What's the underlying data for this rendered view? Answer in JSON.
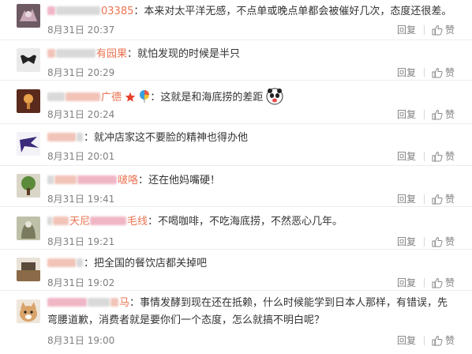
{
  "labels": {
    "reply": "回复",
    "like": "赞"
  },
  "comments": [
    {
      "user": "03385",
      "sep": "：",
      "text": "本来对太平洋无感，不点单或晚点单都会被催好几次，态度还很差。",
      "time": "8月31日 20:37"
    },
    {
      "user": "有园果",
      "sep": "：",
      "text": "就怕发现的时候是半只",
      "time": "8月31日 20:29"
    },
    {
      "user": "广德",
      "sep": "：",
      "text": "这就是和海底捞的差距",
      "time": "8月31日 20:24"
    },
    {
      "user": "",
      "sep": "：",
      "text": "就冲店家这不要脸的精神也得办他",
      "time": "8月31日 20:01"
    },
    {
      "user": "啵咯",
      "sep": "：",
      "text": "还在他妈嘴硬！",
      "time": "8月31日 19:41"
    },
    {
      "user": "天尼",
      "user2": "毛线",
      "sep": "：",
      "text": "不喝咖啡，不吃海底捞，不然恶心几年。",
      "time": "8月31日 19:21"
    },
    {
      "user": "",
      "sep": "：",
      "text": "把全国的餐饮店都关掉吧",
      "time": "8月31日 19:02"
    },
    {
      "user": "马",
      "sep": "：",
      "text": "事情发酵到现在还在抵赖，什么时候能学到日本人那样，有错误，先弯腰道歉，消费者就是要你们一个态度，怎么就搞不明白呢？",
      "time": "8月31日 19:00"
    }
  ]
}
